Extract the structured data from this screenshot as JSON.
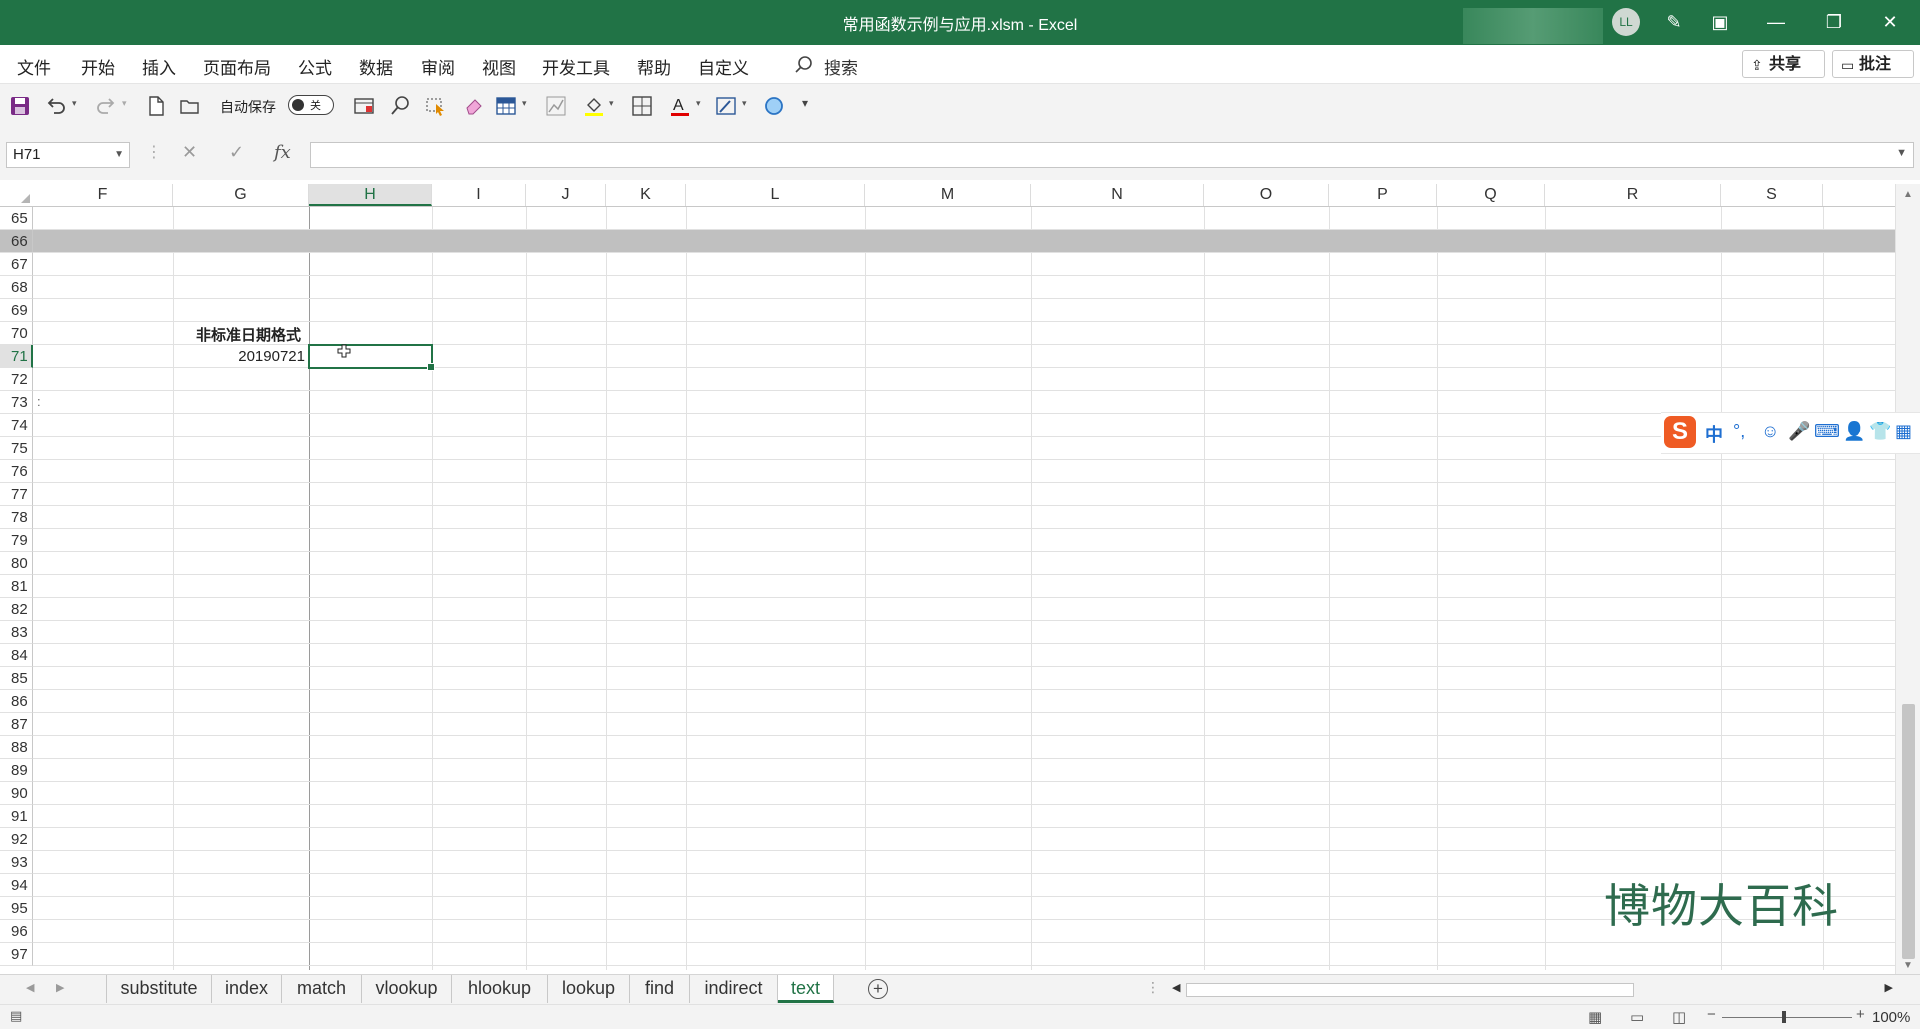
{
  "window": {
    "title": "常用函数示例与应用.xlsm  -  Excel",
    "user_initials": "LL",
    "controls": [
      "✎",
      "▣",
      "—",
      "❐",
      "✕"
    ]
  },
  "menu": {
    "items": [
      "文件",
      "开始",
      "插入",
      "页面布局",
      "公式",
      "数据",
      "审阅",
      "视图",
      "开发工具",
      "帮助",
      "自定义"
    ],
    "search_label": "搜索",
    "share_label": "共享",
    "comment_label": "批注"
  },
  "qat": {
    "autosave_label": "自动保存",
    "autosave_state": "关",
    "icons": [
      "save-icon",
      "undo-icon",
      "redo-icon",
      "new-file-icon",
      "open-file-icon",
      "form-icon",
      "find-icon",
      "select-objects-icon",
      "eraser-icon",
      "table-icon",
      "chart-icon",
      "fill-color-icon",
      "borders-icon",
      "font-color-icon",
      "cell-style-icon",
      "circle-icon",
      "more-icon"
    ]
  },
  "formula_bar": {
    "name_box": "H71",
    "cancel_symbol": "✕",
    "enter_symbol": "✓",
    "fx_symbol": "fx",
    "formula": ""
  },
  "grid": {
    "columns": [
      "F",
      "G",
      "H",
      "I",
      "J",
      "K",
      "L",
      "M",
      "N",
      "O",
      "P",
      "Q",
      "R",
      "S"
    ],
    "selected_column": "H",
    "rows": [
      "65",
      "66",
      "67",
      "68",
      "69",
      "70",
      "71",
      "72",
      "73",
      "74",
      "75",
      "76",
      "77",
      "78",
      "79",
      "80",
      "81",
      "82",
      "83",
      "84",
      "85",
      "86",
      "87",
      "88",
      "89",
      "90",
      "91",
      "92",
      "93",
      "94",
      "95",
      "96",
      "97"
    ],
    "selected_row": "71",
    "cells": {
      "G70": "非标准日期格式",
      "G71": "20190721",
      "row73_marker": ":"
    }
  },
  "ime": {
    "logo": "S",
    "mode": "中",
    "icons": [
      "°,",
      "☺",
      "🎤",
      "⌨",
      "👤",
      "👕",
      "▦"
    ]
  },
  "watermark": "博物大百科",
  "sheets": {
    "tabs": [
      "substitute",
      "index",
      "match",
      "vlookup",
      "hlookup",
      "lookup",
      "find",
      "indirect",
      "text"
    ],
    "active": "text",
    "add_symbol": "+"
  },
  "status": {
    "zoom": "100%",
    "zoom_minus": "−",
    "zoom_plus": "+"
  },
  "colors": {
    "excel_green": "#217346",
    "band_gray": "#c0c0c0",
    "ime_blue": "#1f6fd1",
    "ime_orange": "#ef5b24"
  }
}
